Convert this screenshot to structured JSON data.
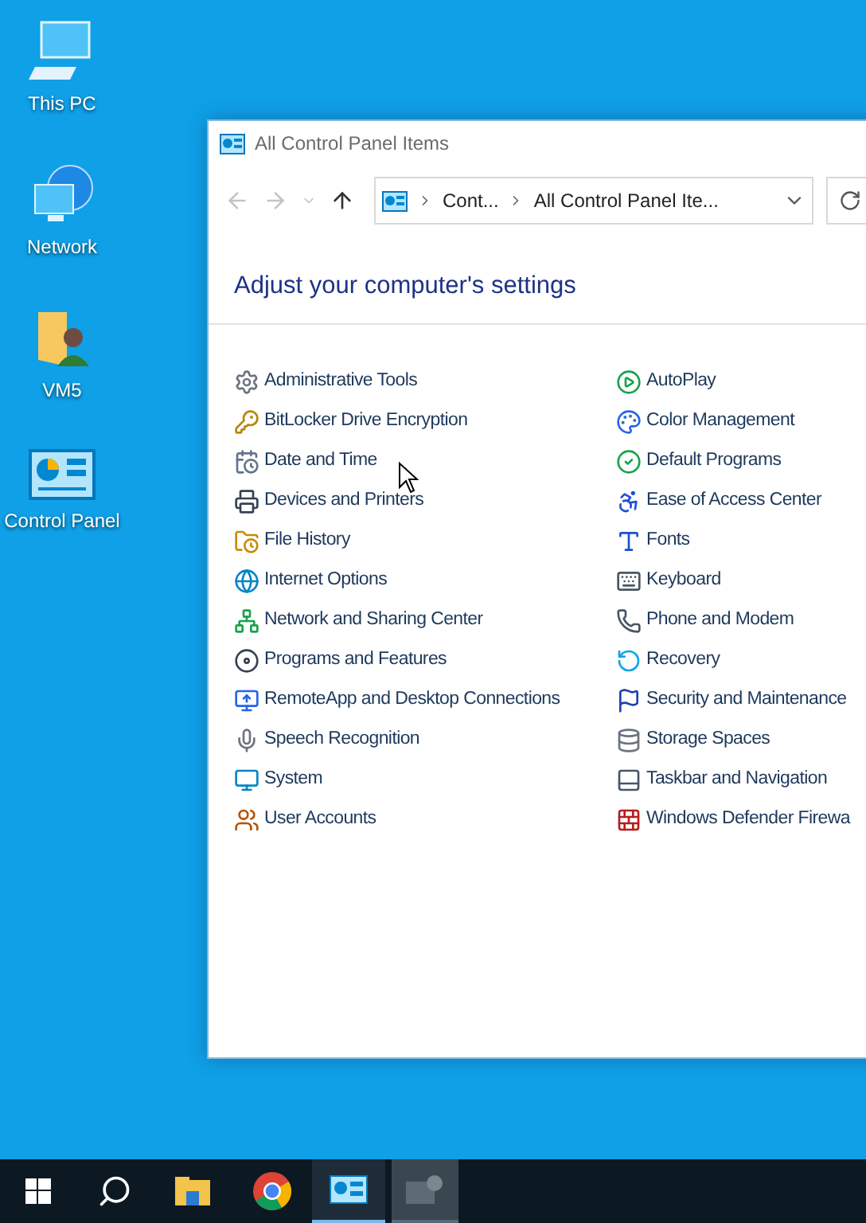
{
  "desktop_icons": [
    {
      "label": "This PC"
    },
    {
      "label": "Network"
    },
    {
      "label": "VM5"
    },
    {
      "label": "Control Panel"
    }
  ],
  "window": {
    "title": "All Control Panel Items",
    "nav": [
      {
        "kind": "back",
        "disabled": true
      },
      {
        "kind": "forward",
        "disabled": true
      },
      {
        "kind": "recent",
        "disabled": true
      },
      {
        "kind": "up",
        "disabled": false
      }
    ],
    "breadcrumb": [
      "Cont...",
      "All Control Panel Ite..."
    ],
    "heading": "Adjust your computer's settings",
    "items": [
      {
        "label": "Administrative Tools"
      },
      {
        "label": "AutoPlay"
      },
      {
        "label": "BitLocker Drive Encryption"
      },
      {
        "label": "Color Management"
      },
      {
        "label": "Date and Time"
      },
      {
        "label": "Default Programs"
      },
      {
        "label": "Devices and Printers"
      },
      {
        "label": "Ease of Access Center"
      },
      {
        "label": "File History"
      },
      {
        "label": "Fonts"
      },
      {
        "label": "Internet Options"
      },
      {
        "label": "Keyboard"
      },
      {
        "label": "Network and Sharing Center"
      },
      {
        "label": "Phone and Modem"
      },
      {
        "label": "Programs and Features"
      },
      {
        "label": "Recovery"
      },
      {
        "label": "RemoteApp and Desktop Connections"
      },
      {
        "label": "Security and Maintenance"
      },
      {
        "label": "Speech Recognition"
      },
      {
        "label": "Storage Spaces"
      },
      {
        "label": "System"
      },
      {
        "label": "Taskbar and Navigation"
      },
      {
        "label": "User Accounts"
      },
      {
        "label": "Windows Defender Firewa"
      }
    ]
  }
}
